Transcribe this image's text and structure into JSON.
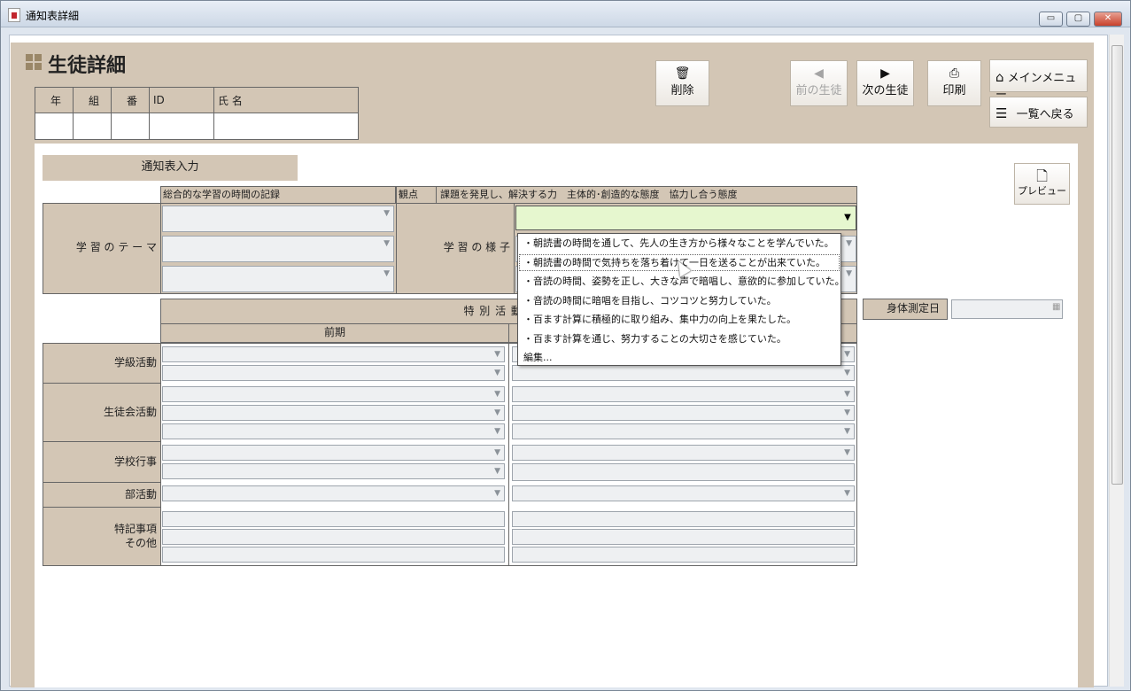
{
  "window": {
    "title": "通知表詳細",
    "minimize": "▭",
    "maximize": "▢",
    "close": "✕"
  },
  "page": {
    "title": "生徒詳細"
  },
  "student_table": {
    "headers": [
      "年",
      "組",
      "番",
      "ID",
      "氏 名"
    ],
    "values": [
      "",
      "",
      "",
      "",
      ""
    ]
  },
  "toolbar": {
    "delete": {
      "icon": "trash-icon",
      "label": "削除"
    },
    "prev": {
      "icon": "◀",
      "label": "前の生徒"
    },
    "next": {
      "icon": "▶",
      "label": "次の生徒"
    },
    "print": {
      "icon": "printer-icon",
      "label": "印刷"
    },
    "main_menu": {
      "icon": "home-icon",
      "label": "メインメニュー"
    },
    "list_back": {
      "icon": "list-icon",
      "label": "一覧へ戻る"
    },
    "preview": {
      "icon": "document-icon",
      "label": "プレビュー"
    }
  },
  "section": {
    "title": "通知表入力"
  },
  "integrated": {
    "header": "総合的な学習の時間の記録",
    "viewpoint_label": "観点",
    "viewpoints": "課題を発見し、解決する力　主体的･創造的な態度　協力し合う態度",
    "theme_label": "学 習 の テ ー マ",
    "state_label": "学 習 の 様 子"
  },
  "special": {
    "header": "特 別 活 動 の 記",
    "first_term": "前期",
    "rows": [
      "学級活動",
      "生徒会活動",
      "学校行事",
      "部活動",
      "特記事項\nその他"
    ]
  },
  "body_measure": {
    "label": "身体測定日",
    "value": ""
  },
  "dropdown": {
    "items": [
      "・朝読書の時間を通して、先人の生き方から様々なことを学んでいた。",
      "・朝読書の時間で気持ちを落ち着けて一日を送ることが出来ていた。",
      "・音読の時間、姿勢を正し、大きな声で暗唱し、意欲的に参加していた。",
      "・音読の時間に暗唱を目指し、コツコツと努力していた。",
      "・百ます計算に積極的に取り組み、集中力の向上を果たした。",
      "・百ます計算を通じ、努力することの大切さを感じていた。",
      "編集..."
    ]
  }
}
